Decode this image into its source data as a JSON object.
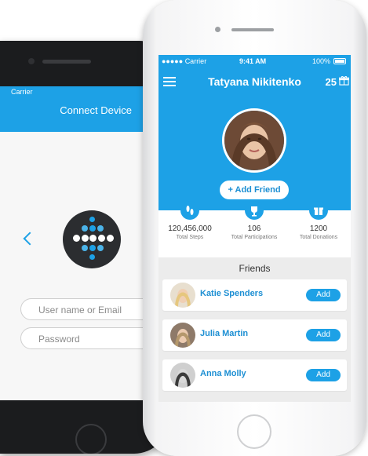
{
  "back_device": {
    "status": {
      "carrier": "Carrier"
    },
    "title": "Connect Device",
    "username_placeholder": "User name or Email",
    "password_placeholder": "Password"
  },
  "front_device": {
    "status": {
      "carrier": "Carrier",
      "time": "9:41 AM",
      "battery": "100%"
    },
    "header": {
      "name": "Tatyana Nikitenko",
      "count": "25"
    },
    "add_friend_label": "+ Add Friend",
    "stats": [
      {
        "icon": "footsteps-icon",
        "value": "120,456,000",
        "label": "Total Steps"
      },
      {
        "icon": "trophy-icon",
        "value": "106",
        "label": "Total Participations"
      },
      {
        "icon": "gift-icon",
        "value": "1200",
        "label": "Total Donations"
      }
    ],
    "friends_title": "Friends",
    "friends": [
      {
        "name": "Katie Spenders",
        "action": "Add"
      },
      {
        "name": "Julia Martin",
        "action": "Add"
      },
      {
        "name": "Anna Molly",
        "action": "Add"
      }
    ]
  },
  "colors": {
    "accent": "#1da1e6",
    "link": "#1d8fd3",
    "background": "#ececec"
  }
}
